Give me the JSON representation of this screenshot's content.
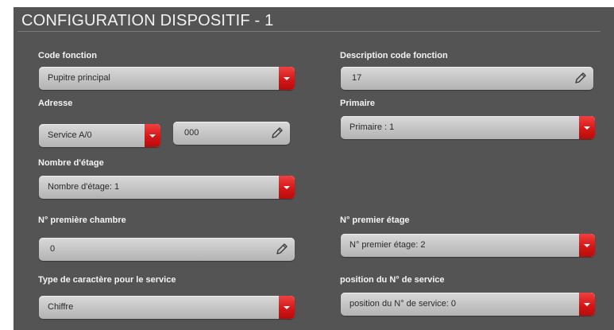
{
  "title": "CONFIGURATION DISPOSITIF - 1",
  "code_fonction": {
    "label": "Code fonction",
    "value": "Pupitre principal",
    "icon": "chevron-down-icon"
  },
  "description_code_fonction": {
    "label": "Description code fonction",
    "value": "17",
    "icon": "pencil-icon"
  },
  "adresse": {
    "label": "Adresse",
    "service": "Service A/0",
    "number": "000"
  },
  "primaire": {
    "label": "Primaire",
    "value": "Primaire : 1"
  },
  "nombre_etage": {
    "label": "Nombre d'étage",
    "value": "Nombre d'étage: 1"
  },
  "premiere_chambre": {
    "label": "N° première chambre",
    "value": "0"
  },
  "premier_etage": {
    "label": "N° premier étage",
    "value": "N° premier étage: 2"
  },
  "type_caractere": {
    "label": "Type de caractère pour le service",
    "value": "Chiffre"
  },
  "position_service": {
    "label": "position du N° de service",
    "value": "position du N° de service: 0"
  },
  "colors": {
    "panel": "#545454",
    "dropdown_accent": "#d61616",
    "field": "#c8c8c8"
  }
}
